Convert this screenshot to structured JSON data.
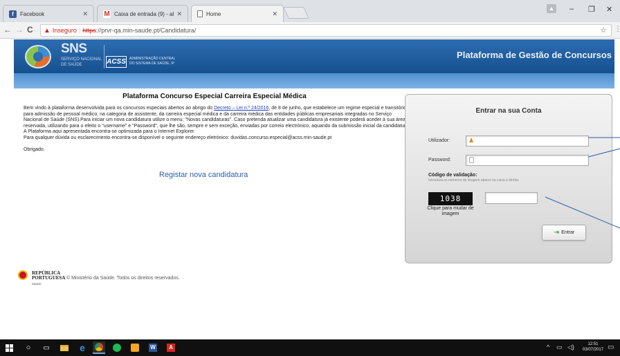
{
  "browser": {
    "tabs": [
      {
        "label": "Facebook",
        "icon": "facebook-icon",
        "color": "#3b5998"
      },
      {
        "label": "Caixa de entrada (9) - al",
        "icon": "gmail-icon",
        "color": "#d93025"
      },
      {
        "label": "Home",
        "icon": "page-icon",
        "color": "#ffffff"
      }
    ],
    "security_label": "Inseguro",
    "url_scheme": "https",
    "url_rest": "://prvr-qa.min-saude.pt/Candidatura/"
  },
  "header": {
    "sns_title": "SNS",
    "sns_subtitle_1": "SERVIÇO NACIONAL",
    "sns_subtitle_2": "DE SAÚDE",
    "acss_badge": "ACSS",
    "acss_text_1": "ADMINISTRAÇÃO CENTRAL",
    "acss_text_2": "DO SISTEMA DE SAÚDE, IP",
    "platform_title": "Plataforma de Gestão de Concursos"
  },
  "main": {
    "title": "Plataforma Concurso Especial Carreira Especial Médica",
    "intro_before_link": "Bem vindo à plataforma desenvolvida para os concursos especiais abertos ao abrigo do ",
    "decree_link": "Decreto – Lei n.º 24/2016",
    "intro_after_link": ", de 8 de junho, que estabelece um regime especial e transitório para admissão de pessoal médico, na categoria de assistente, da carreira especial médica e da carreira médica das entidades públicas empresariais integradas no Serviço Nacional de Saúde (SNS).Para iniciar um nova candidatura utilize o menu: \"Novas candidaturas\". Caso pretenda atualizar uma candidatura já existente poderá aceder à sua área reservada, utilizando para o efeito o \"username\" e \"Password\", que lhe são, sempre e sem exceção, enviadas por correio electrónico, aquando da submissão inicial da candidatura. A Plataforma aqui apresentada encontra-se optimizada para o Internet Explorer.",
    "contact": "Para qualquer dúvida ou esclarecimento encontra-se disponível o seguinte endereço eletrónico: duvidas.concurso.especial@acss.min-saude.pt",
    "thanks": "Obrigado.",
    "register_link": "Registar nova candidatura"
  },
  "login": {
    "title": "Entrar na sua Conta",
    "user_label": "Utilizador:",
    "password_label": "Password:",
    "captcha_title": "Código de validação:",
    "captcha_hint": "Introduza os números da imagem abaixo na caixa à direita.",
    "captcha_code": "1038",
    "captcha_refresh": "Clique para mudar de imagem",
    "submit_label": "Entrar"
  },
  "footer": {
    "republic_1": "REPÚBLICA",
    "republic_2": "PORTUGUESA",
    "republic_3": "SAÚDE",
    "copyright": "© Ministério da Saúde. Todos os direitos reservados."
  },
  "taskbar": {
    "time": "12:51",
    "date": "03/07/2017"
  }
}
